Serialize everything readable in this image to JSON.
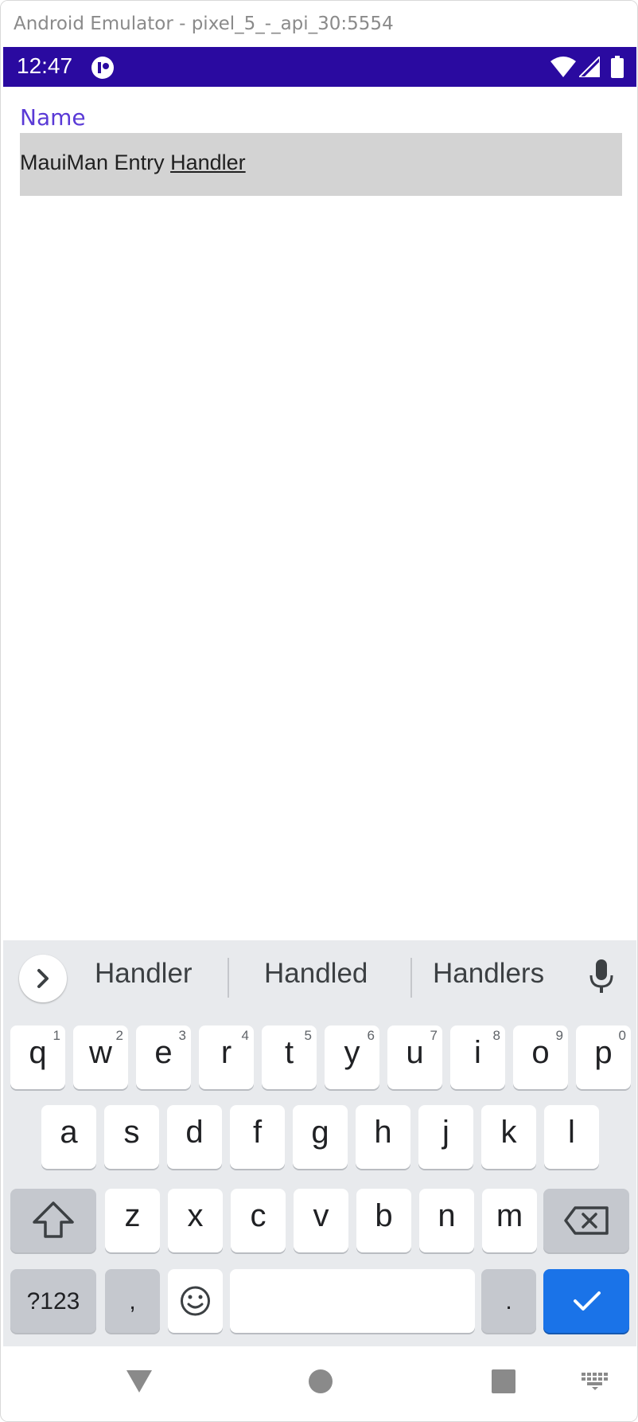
{
  "window": {
    "title": "Android Emulator - pixel_5_-_api_30:5554"
  },
  "status_bar": {
    "time": "12:47"
  },
  "form": {
    "label": "Name",
    "entry_text_plain": "MauiMan Entry ",
    "entry_text_underlined": "Handler"
  },
  "keyboard": {
    "suggestions": [
      "Handler",
      "Handled",
      "Handlers"
    ],
    "row1": [
      {
        "ch": "q",
        "num": "1"
      },
      {
        "ch": "w",
        "num": "2"
      },
      {
        "ch": "e",
        "num": "3"
      },
      {
        "ch": "r",
        "num": "4"
      },
      {
        "ch": "t",
        "num": "5"
      },
      {
        "ch": "y",
        "num": "6"
      },
      {
        "ch": "u",
        "num": "7"
      },
      {
        "ch": "i",
        "num": "8"
      },
      {
        "ch": "o",
        "num": "9"
      },
      {
        "ch": "p",
        "num": "0"
      }
    ],
    "row2": [
      "a",
      "s",
      "d",
      "f",
      "g",
      "h",
      "j",
      "k",
      "l"
    ],
    "row3": [
      "z",
      "x",
      "c",
      "v",
      "b",
      "n",
      "m"
    ],
    "symbols_label": "?123",
    "comma_label": ",",
    "period_label": "."
  }
}
